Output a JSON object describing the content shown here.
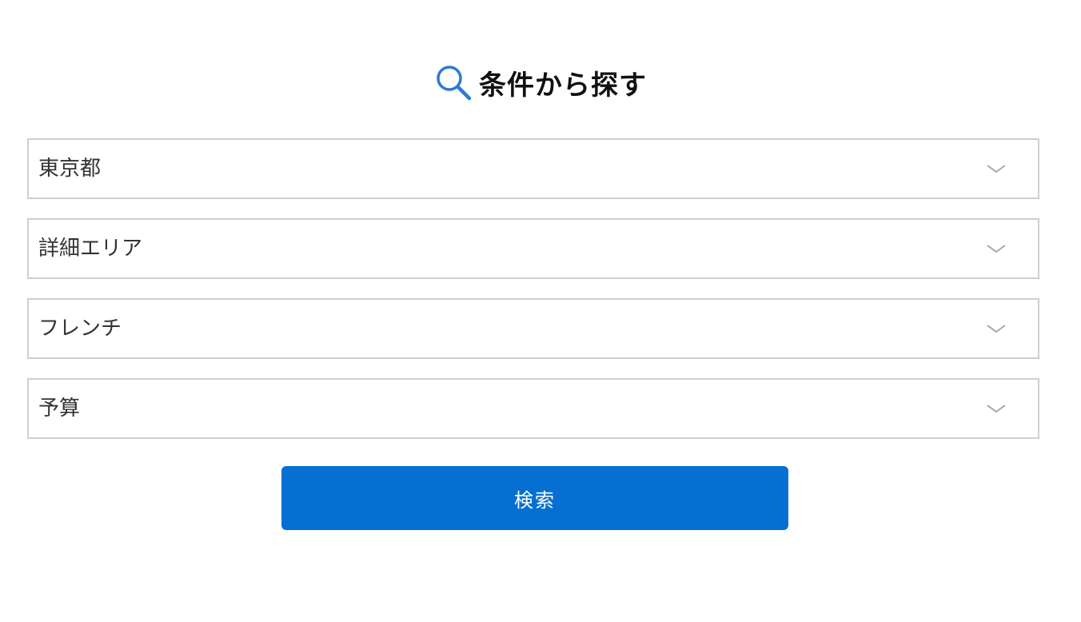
{
  "header": {
    "icon": "search-icon",
    "title": "条件から探す",
    "icon_color": "#2b7bd3"
  },
  "filters": [
    {
      "value": "東京都",
      "icon": "chevron-down-icon"
    },
    {
      "value": "詳細エリア",
      "icon": "chevron-down-icon"
    },
    {
      "value": "フレンチ",
      "icon": "chevron-down-icon"
    },
    {
      "value": "予算",
      "icon": "chevron-down-icon"
    }
  ],
  "search_button": {
    "label": "検索",
    "color": "#0570d1"
  }
}
